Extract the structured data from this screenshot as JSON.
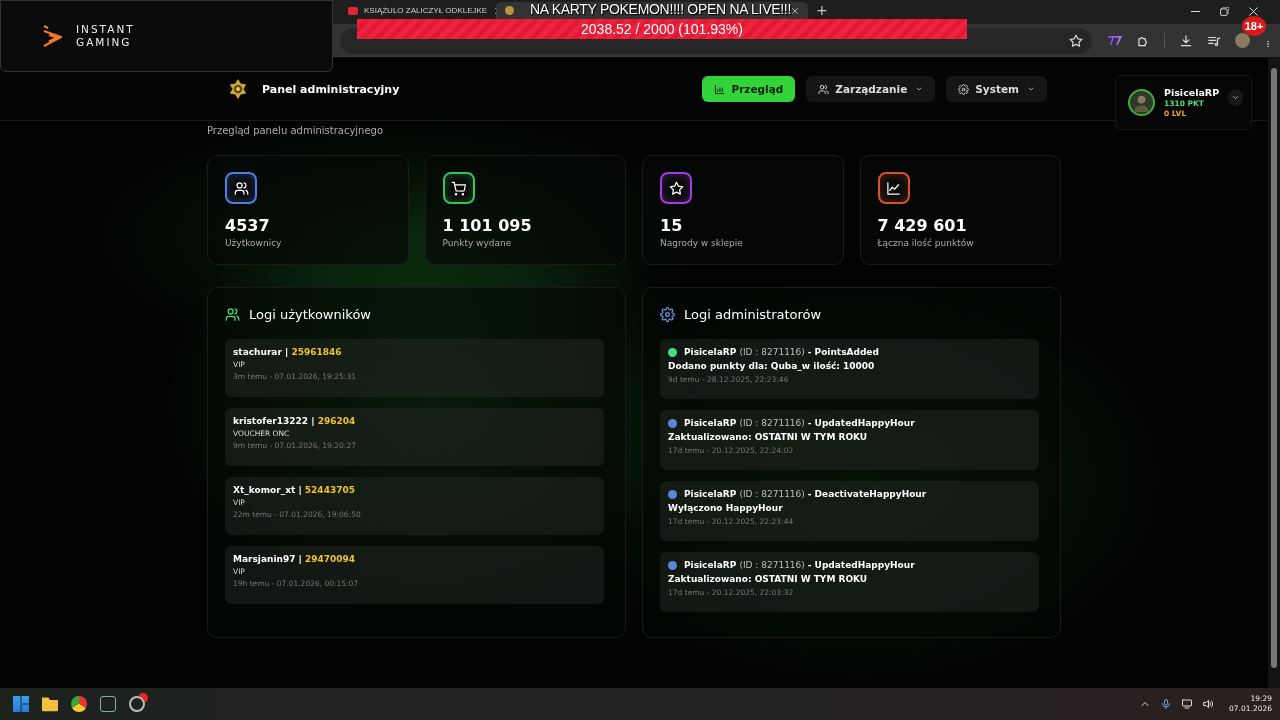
{
  "stream_overlay": {
    "sponsor": {
      "line_1": "INSTANT",
      "line_2": "GAMING"
    },
    "goal": {
      "title": "NA KARTY POKEMON!!!! OPEN NA LIVE!!!",
      "reading": "2038.52 / 2000 (101.93%)",
      "level": 1
    },
    "age_badge": "18+"
  },
  "browser": {
    "tabs": [
      {
        "title": "KSIĄŻULO ZALICZYŁ ODKLEJKE",
        "kind": "video"
      },
      {
        "kind": "site"
      }
    ],
    "new_tab": "+"
  },
  "header": {
    "title": "Panel administracyjny",
    "nav": [
      {
        "label": "Przegląd",
        "selected": true,
        "kind": "bars",
        "dropdown": false
      },
      {
        "label": "Zarządzanie",
        "selected": false,
        "kind": "users",
        "dropdown": true
      },
      {
        "label": "System",
        "selected": false,
        "kind": "gear",
        "dropdown": true
      }
    ],
    "user": {
      "name": "PisicelaRP",
      "points": "1310 PKT",
      "level_text": "0 LVL"
    }
  },
  "subtitle": "Przegląd panelu administracyjnego",
  "stats": [
    {
      "value": "4537",
      "label": "Użytkownicy",
      "kind": "users",
      "color": "#4d7fe6"
    },
    {
      "value": "1 101 095",
      "label": "Punkty wydane",
      "kind": "cart",
      "color": "#32c45e"
    },
    {
      "value": "15",
      "label": "Nagrody w sklepie",
      "kind": "star",
      "color": "#a13fe0"
    },
    {
      "value": "7 429 601",
      "label": "Łączna ilość punktów",
      "kind": "chart",
      "color": "#d4562e"
    }
  ],
  "user_logs": {
    "title": "Logi użytkowników",
    "entries": [
      {
        "user": "stachurar",
        "separator": "|",
        "code": "25961846",
        "reward": "VIP",
        "time": "3m temu - 07.01.2026, 19:25:31"
      },
      {
        "user": "kristofer13222",
        "separator": "|",
        "code": "296204",
        "reward": "VOUCHER ONC",
        "time": "9m temu - 07.01.2026, 19:20:27"
      },
      {
        "user": "Xt_komor_xt",
        "separator": "|",
        "code": "52443705",
        "reward": "VIP",
        "time": "22m temu - 07.01.2026, 19:06:50"
      },
      {
        "user": "Marsjanin97",
        "separator": "|",
        "code": "29470094",
        "reward": "VIP",
        "time": "19h temu - 07.01.2026, 00:15:07"
      }
    ]
  },
  "admin_logs": {
    "title": "Logi administratorów",
    "entries": [
      {
        "actor": "PisicelaRP",
        "id": "(ID : 8271116)",
        "action": "- PointsAdded",
        "message": "Dodano punkty dla: Quba_w ilość: 10000",
        "time": "9d temu - 28.12.2025, 22:23:46",
        "color": "#4ade80"
      },
      {
        "actor": "PisicelaRP",
        "id": "(ID : 8271116)",
        "action": "- UpdatedHappyHour",
        "message": "Zaktualizowano: OSTATNI W TYM ROKU",
        "time": "17d temu - 20.12.2025, 22:24:02",
        "color": "#5b86d9"
      },
      {
        "actor": "PisicelaRP",
        "id": "(ID : 8271116)",
        "action": "- DeactivateHappyHour",
        "message": "Wyłączono HappyHour",
        "time": "17d temu - 20.12.2025, 22:23:44",
        "color": "#5b86d9"
      },
      {
        "actor": "PisicelaRP",
        "id": "(ID : 8271116)",
        "action": "- UpdatedHappyHour",
        "message": "Zaktualizowano: OSTATNI W TYM ROKU",
        "time": "17d temu - 20.12.2025, 22:03:32",
        "color": "#5b86d9"
      }
    ]
  },
  "taskbar": {
    "time": "19:29",
    "date": "07.01.2026"
  }
}
